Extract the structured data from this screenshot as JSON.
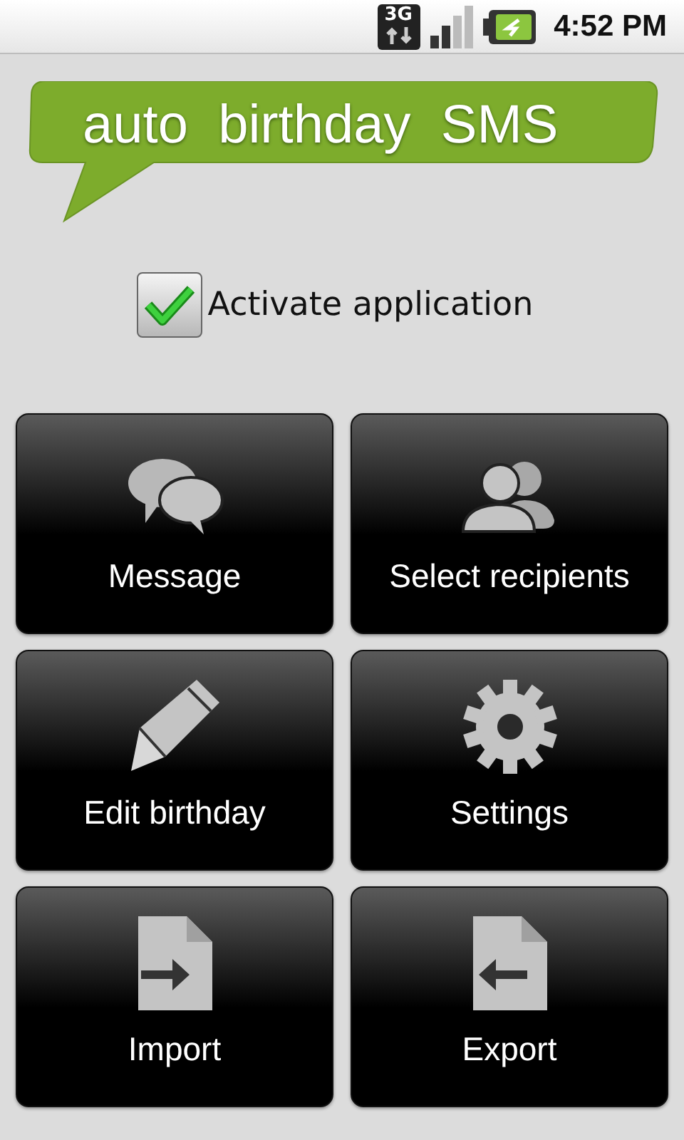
{
  "status_bar": {
    "network": "3G",
    "time": "4:52 PM"
  },
  "banner": {
    "title": "auto  birthday  SMS"
  },
  "activate": {
    "label": "Activate application",
    "checked": true
  },
  "buttons": [
    {
      "label": "Message",
      "kind": "chat"
    },
    {
      "label": "Select recipients",
      "kind": "people"
    },
    {
      "label": "Edit birthday",
      "kind": "pencil"
    },
    {
      "label": "Settings",
      "kind": "gear"
    },
    {
      "label": "Import",
      "kind": "file-in"
    },
    {
      "label": "Export",
      "kind": "file-out"
    }
  ]
}
